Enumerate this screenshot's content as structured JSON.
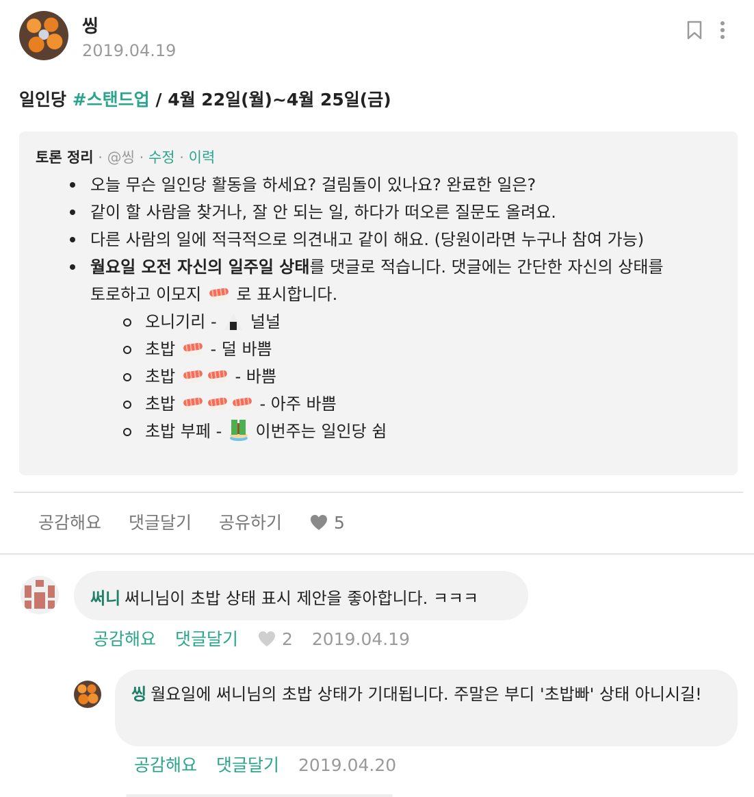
{
  "post": {
    "author": "씽",
    "date": "2019.04.19",
    "title_prefix": "일인당 ",
    "title_tag": "#스탠드업",
    "title_suffix": " / 4월 22일(월)~4월 25일(금)"
  },
  "summary": {
    "heading": "토론 정리",
    "sep1": " · ",
    "by": "@씽",
    "sep2": " · ",
    "edit": "수정",
    "sep3": " · ",
    "history": "이력",
    "bullets": [
      "오늘 무슨 일인당 활동을 하세요? 걸림돌이 있나요? 완료한 일은?",
      "같이 할 사람을 찾거나, 잘 안 되는 일, 하다가 떠오른 질문도 올려요.",
      "다른 사람의 일에 적극적으로 의견내고 같이 해요. (당원이라면 누구나 참여 가능)"
    ],
    "bullet4_bold": "월요일 오전 자신의 일주일 상태",
    "bullet4_rest1": "를 댓글로 적습니다. 댓글에는 간단한 자신의 상태를",
    "bullet4_rest2": "토로하고 이모지",
    "bullet4_rest3": "로 표시합니다.",
    "sub": [
      {
        "label": "오니기리 -",
        "desc": "널널"
      },
      {
        "label": "초밥",
        "desc": "- 덜 바쁨"
      },
      {
        "label": "초밥",
        "desc": "- 바쁨"
      },
      {
        "label": "초밥",
        "desc": "- 아주 바쁨"
      },
      {
        "label": "초밥 부페 -",
        "desc": "이번주는 일인당 쉼"
      }
    ],
    "emoji": [
      "rice-ball-icon",
      "sushi-icon",
      "desert-island-icon"
    ]
  },
  "actions": {
    "like": "공감해요",
    "comment": "댓글달기",
    "share": "공유하기",
    "likes_count": "5"
  },
  "comments": [
    {
      "author": "써니",
      "text": "써니님이 초밥 상태 표시 제안을 좋아합니다. ㅋㅋㅋ",
      "like": "공감해요",
      "reply": "댓글달기",
      "likes": "2",
      "date": "2019.04.19"
    },
    {
      "author": "씽",
      "text": "월요일에 써니님의 초밥 상태가 기대됩니다. 주말은 부디 '초밥빠' 상태 아니시길!",
      "like": "공감해요",
      "reply": "댓글달기",
      "date": "2019.04.20"
    }
  ],
  "colors": {
    "accent": "#2aa58c",
    "name": "#1f7f67",
    "muted": "#9a9a9a",
    "box": "#f3f3f3"
  }
}
